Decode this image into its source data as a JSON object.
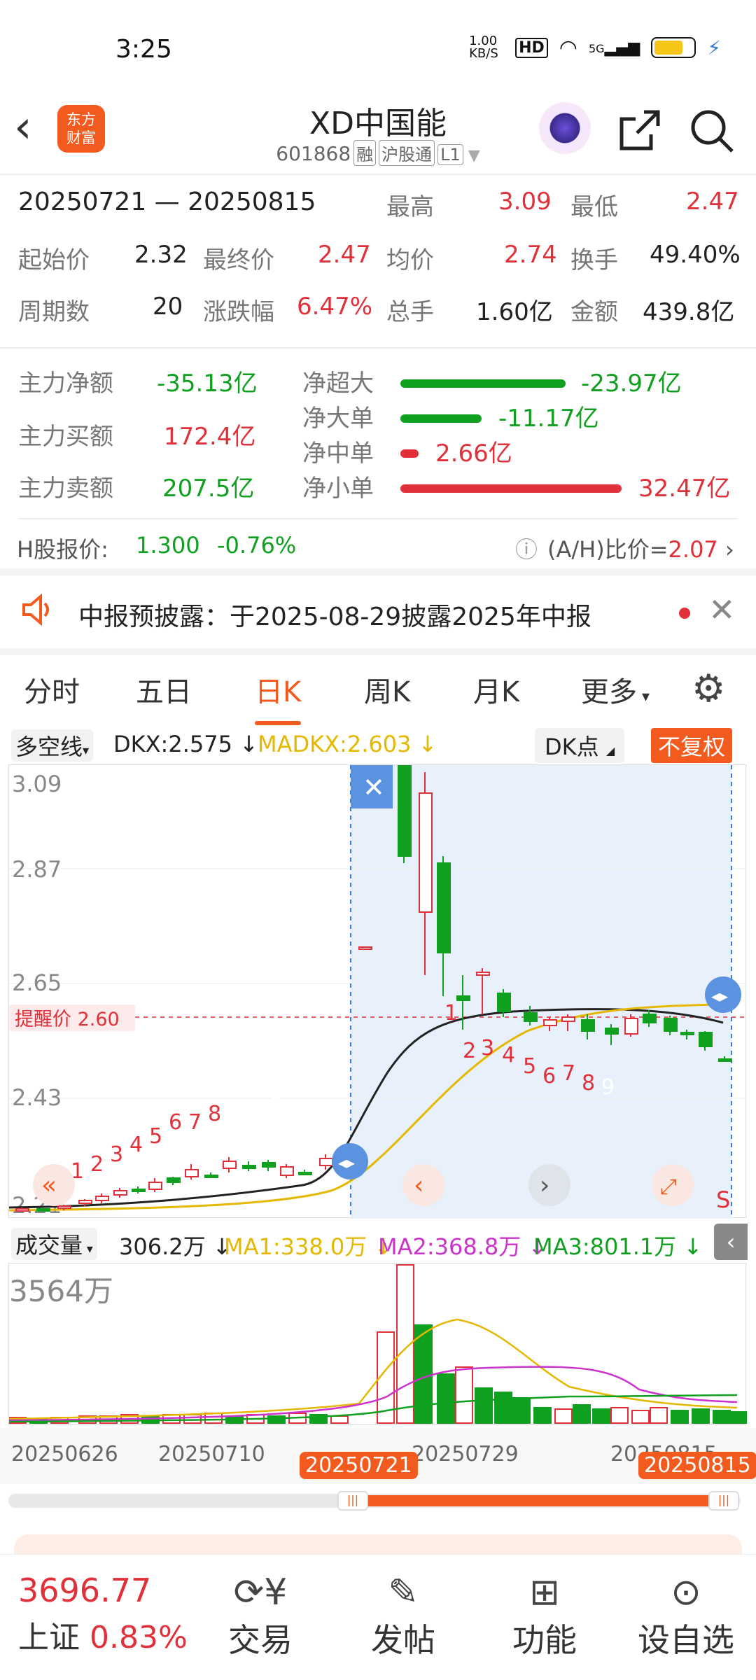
{
  "status": {
    "time": "3:25",
    "speed": "1.00\nKB/S",
    "hd": "HD",
    "net": "5G"
  },
  "nav": {
    "stock_name": "XD中国能",
    "code": "601868",
    "tag1": "融",
    "tag2": "沪股通",
    "tag3": "L1",
    "logo": "东方\n财富"
  },
  "range": {
    "period": "20250721 — 20250815",
    "high_label": "最高",
    "high": "3.09",
    "low_label": "最低",
    "low": "2.47",
    "open_label": "起始价",
    "open": "2.32",
    "close_label": "最终价",
    "close": "2.47",
    "avg_label": "均价",
    "avg": "2.74",
    "turnover_label": "换手",
    "turnover": "49.40%",
    "periods_label": "周期数",
    "periods": "20",
    "chg_label": "涨跌幅",
    "chg": "6.47%",
    "vol_label": "总手",
    "vol": "1.60亿",
    "amt_label": "金额",
    "amt": "439.8亿"
  },
  "flow": {
    "net_label": "主力净额",
    "net": "-35.13亿",
    "buy_label": "主力买额",
    "buy": "172.4亿",
    "sell_label": "主力卖额",
    "sell": "207.5亿",
    "xl_label": "净超大",
    "xl": "-23.97亿",
    "l_label": "净大单",
    "l": "-11.17亿",
    "m_label": "净中单",
    "m": "2.66亿",
    "s_label": "净小单",
    "s": "32.47亿"
  },
  "hshare": {
    "label": "H股报价:",
    "price": "1.300",
    "chg": "-0.76%",
    "ratio_label": "(A/H)比价=",
    "ratio": "2.07"
  },
  "notice": {
    "text": "中报预披露：于2025-08-29披露2025年中报"
  },
  "tabs": [
    "分时",
    "五日",
    "日K",
    "周K",
    "月K",
    "更多"
  ],
  "indicator": {
    "name": "多空线",
    "dkx": "DKX:2.575",
    "madkx": "MADKX:2.603",
    "dk_btn": "DK点",
    "fq_btn": "不复权"
  },
  "chart_labels": {
    "y1": "3.09",
    "y2": "2.87",
    "y3": "2.65",
    "y4": "2.43",
    "y5": "2.21",
    "alert": "提醒价 2.60",
    "s": "S"
  },
  "volume": {
    "name": "成交量",
    "vol": "306.2万",
    "ma1": "MA1:338.0万",
    "ma2": "MA2:368.8万",
    "ma3": "MA3:801.1万",
    "max": "3564万"
  },
  "dates": {
    "d1": "20250626",
    "d2": "20250710",
    "d3": "20250729",
    "d4": "20250815",
    "start": "20250721",
    "end": "20250815"
  },
  "bottom": {
    "index_value": "3696.77",
    "index_name": "上证",
    "index_chg": "0.83%",
    "trade": "交易",
    "post": "发帖",
    "func": "功能",
    "watch": "设自选"
  },
  "colors": {
    "up": "#e0303a",
    "down": "#10a020",
    "accent": "#f25a1e",
    "madkx": "#e5b800",
    "ma3": "#cc33cc"
  }
}
